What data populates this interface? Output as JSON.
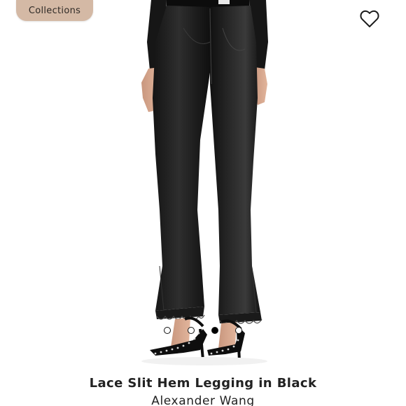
{
  "header": {
    "collections_label": "Collections",
    "wishlist_icon": "heart-outline-icon"
  },
  "gallery": {
    "image_description_name": "product-photo",
    "slide_count": 4,
    "active_slide": 3
  },
  "product": {
    "title": "Lace Slit Hem Legging in Black",
    "brand": "Alexander Wang"
  },
  "colors": {
    "chip_background": "#d4b9a5",
    "dot_active": "#000000",
    "dot_inactive": "#ffffff"
  }
}
